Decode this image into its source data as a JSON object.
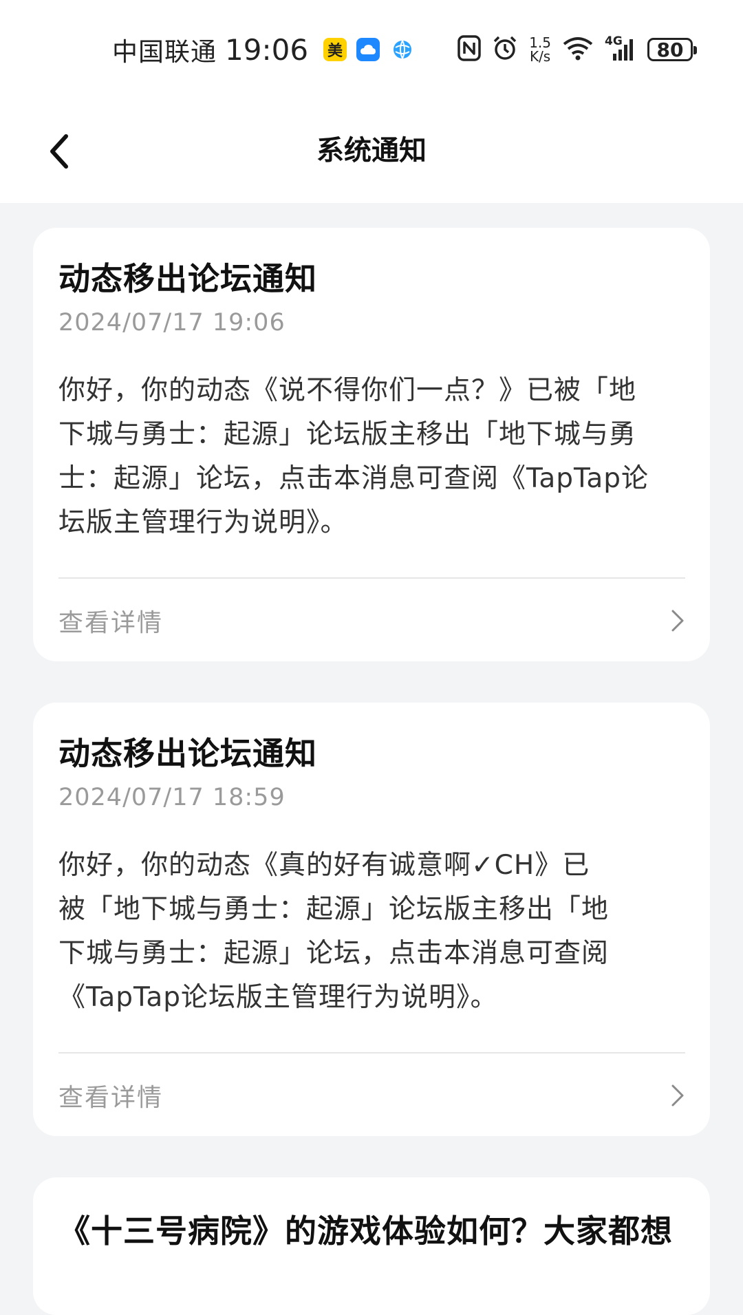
{
  "status_bar": {
    "carrier": "中国联通",
    "time": "19:06",
    "app_badge_label": "美",
    "net_speed_value": "1.5",
    "net_speed_unit": "K/s",
    "network_type": "4G",
    "battery": "80",
    "icons": [
      "meituan-app-icon",
      "cloud-app-icon",
      "browser-app-icon",
      "nfc-icon",
      "alarm-icon",
      "wifi-icon",
      "signal-icon",
      "battery-icon"
    ],
    "colors": {
      "meituan": "#ffd100",
      "cloud": "#1e88ff",
      "browser": "#29a3ff"
    }
  },
  "header": {
    "title": "系统通知",
    "back_icon": "chevron-left-icon"
  },
  "notifications": [
    {
      "title": "动态移出论坛通知",
      "date": "2024/07/17 19:06",
      "body_lines": [
        "你好，你的动态《说不得你们一点？》已被「地",
        "下城与勇士：起源」论坛版主移出「地下城与勇",
        "士：起源」论坛，点击本消息可查阅《TapTap论",
        "坛版主管理行为说明》。"
      ],
      "action_label": "查看详情"
    },
    {
      "title": "动态移出论坛通知",
      "date": "2024/07/17 18:59",
      "body_lines": [
        "你好，你的动态《真的好有诚意啊✓CH》已",
        "被「地下城与勇士：起源」论坛版主移出「地",
        "下城与勇士：起源」论坛，点击本消息可查阅",
        "《TapTap论坛版主管理行为说明》。"
      ],
      "action_label": "查看详情"
    },
    {
      "title": "《十三号病院》的游戏体验如何？大家都想"
    }
  ],
  "colors": {
    "page_background": "#f3f4f6",
    "card_background": "#ffffff",
    "secondary_text": "#9a9a9a"
  }
}
